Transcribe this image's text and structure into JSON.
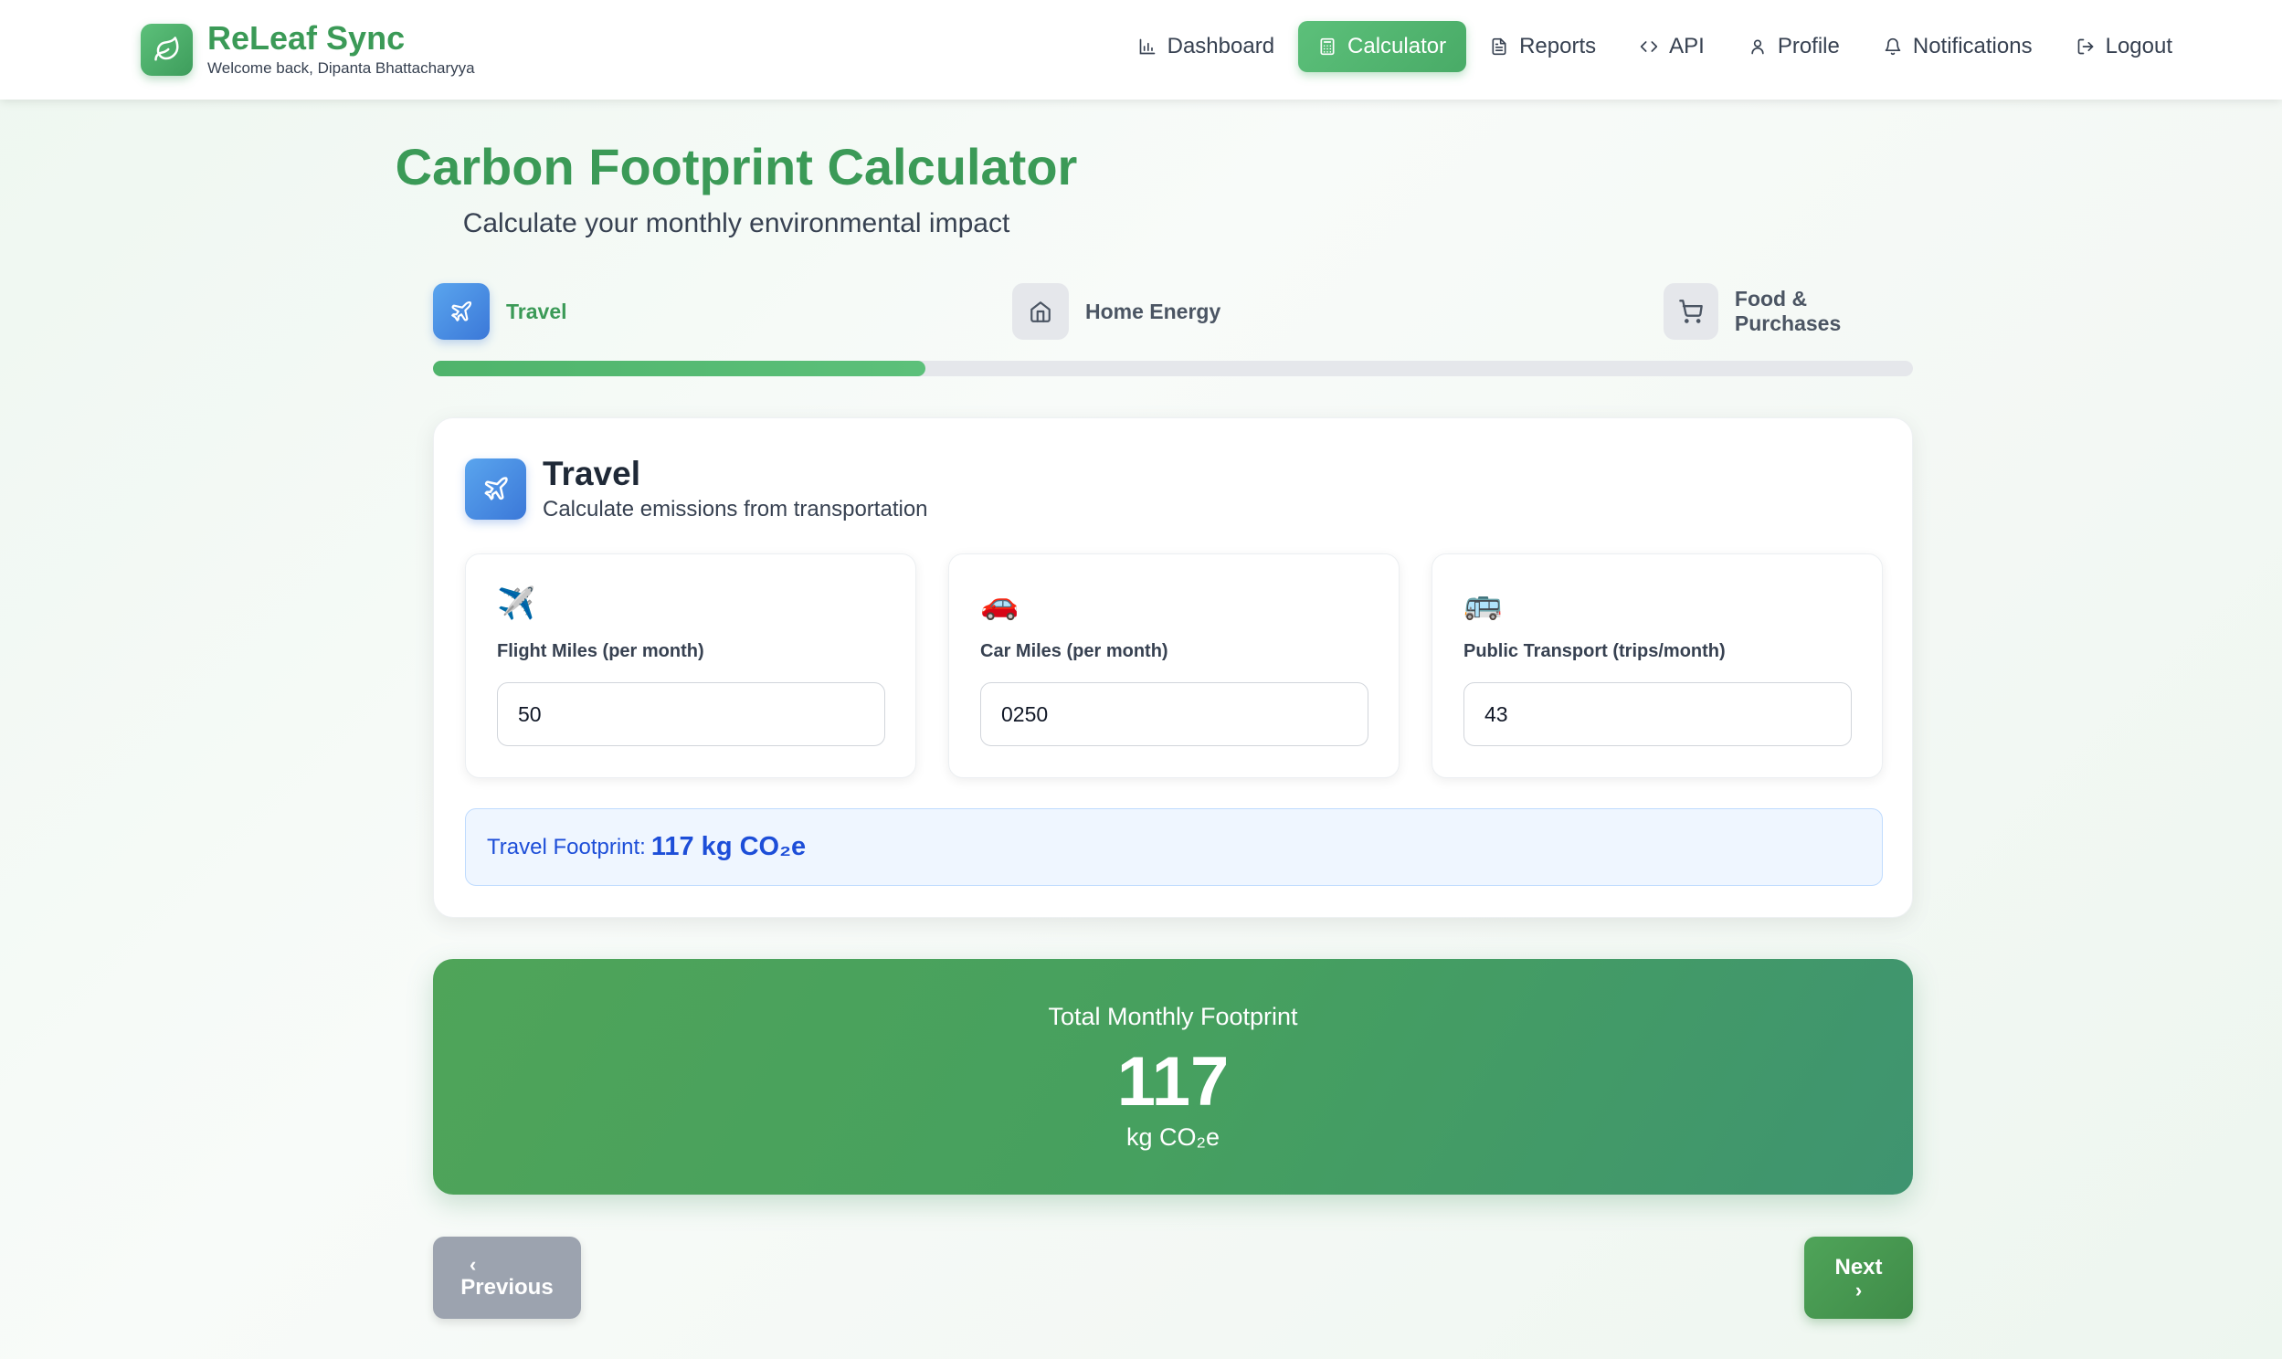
{
  "header": {
    "brand_title": "ReLeaf Sync",
    "brand_subtitle": "Welcome back, Dipanta Bhattacharyya",
    "nav": [
      {
        "label": "Dashboard",
        "icon": "bar-chart-icon",
        "active": false
      },
      {
        "label": "Calculator",
        "icon": "calculator-icon",
        "active": true
      },
      {
        "label": "Reports",
        "icon": "document-icon",
        "active": false
      },
      {
        "label": "API",
        "icon": "code-icon",
        "active": false
      },
      {
        "label": "Profile",
        "icon": "user-icon",
        "active": false
      },
      {
        "label": "Notifications",
        "icon": "bell-icon",
        "active": false
      },
      {
        "label": "Logout",
        "icon": "logout-icon",
        "active": false
      }
    ]
  },
  "page": {
    "title": "Carbon Footprint Calculator",
    "subtitle": "Calculate your monthly environmental impact"
  },
  "steps": [
    {
      "label": "Travel",
      "icon": "plane-icon",
      "active": true
    },
    {
      "label": "Home Energy",
      "icon": "home-icon",
      "active": false
    },
    {
      "label": "Food & Purchases",
      "icon": "cart-icon",
      "active": false
    }
  ],
  "progress": {
    "fraction": 0.333
  },
  "travel": {
    "title": "Travel",
    "subtitle": "Calculate emissions from transportation",
    "fields": [
      {
        "emoji": "✈️",
        "label": "Flight Miles (per month)",
        "value": "50"
      },
      {
        "emoji": "🚗",
        "label": "Car Miles (per month)",
        "value": "0250"
      },
      {
        "emoji": "🚌",
        "label": "Public Transport (trips/month)",
        "value": "43"
      }
    ],
    "summary_label": "Travel Footprint:",
    "summary_value": "117 kg CO₂e"
  },
  "total": {
    "label": "Total Monthly Footprint",
    "value": "117",
    "unit": "kg CO₂e"
  },
  "buttons": {
    "previous": "Previous",
    "next": "Next"
  },
  "colors": {
    "brand_green": "#3b9a57",
    "accent_blue": "#3b78d8",
    "banner_green": "#46a05f",
    "disabled_gray": "#9ca3af"
  }
}
